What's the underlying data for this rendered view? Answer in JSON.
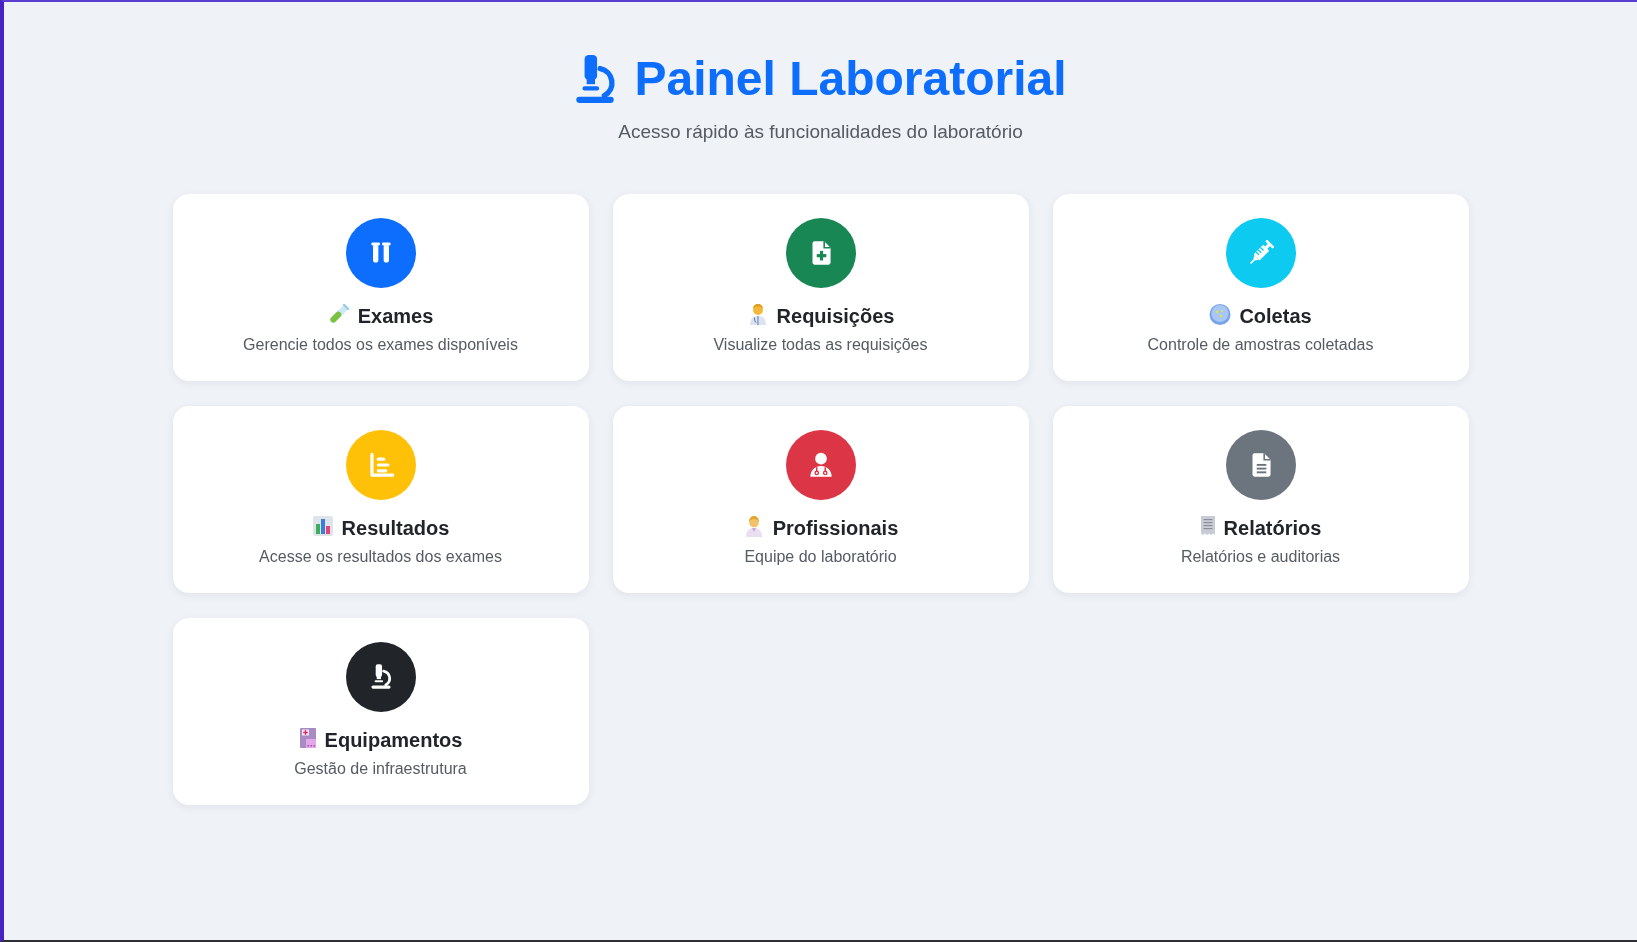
{
  "header": {
    "title": "Painel Laboratorial",
    "subtitle": "Acesso rápido às funcionalidades do laboratório"
  },
  "cards": [
    {
      "kind": "exams",
      "color": "#0d6efd",
      "title": "Exames",
      "description": "Gerencie todos os exames disponíveis"
    },
    {
      "kind": "requisitions",
      "color": "#198754",
      "title": "Requisições",
      "description": "Visualize todas as requisições"
    },
    {
      "kind": "collections",
      "color": "#0dcaf0",
      "title": "Coletas",
      "description": "Controle de amostras coletadas"
    },
    {
      "kind": "results",
      "color": "#ffc107",
      "title": "Resultados",
      "description": "Acesse os resultados dos exames"
    },
    {
      "kind": "professionals",
      "color": "#dc3545",
      "title": "Profissionais",
      "description": "Equipe do laboratório"
    },
    {
      "kind": "reports",
      "color": "#6c757d",
      "title": "Relatórios",
      "description": "Relatórios e auditorias"
    },
    {
      "kind": "equipment",
      "color": "#212529",
      "title": "Equipamentos",
      "description": "Gestão de infraestrutura"
    }
  ]
}
